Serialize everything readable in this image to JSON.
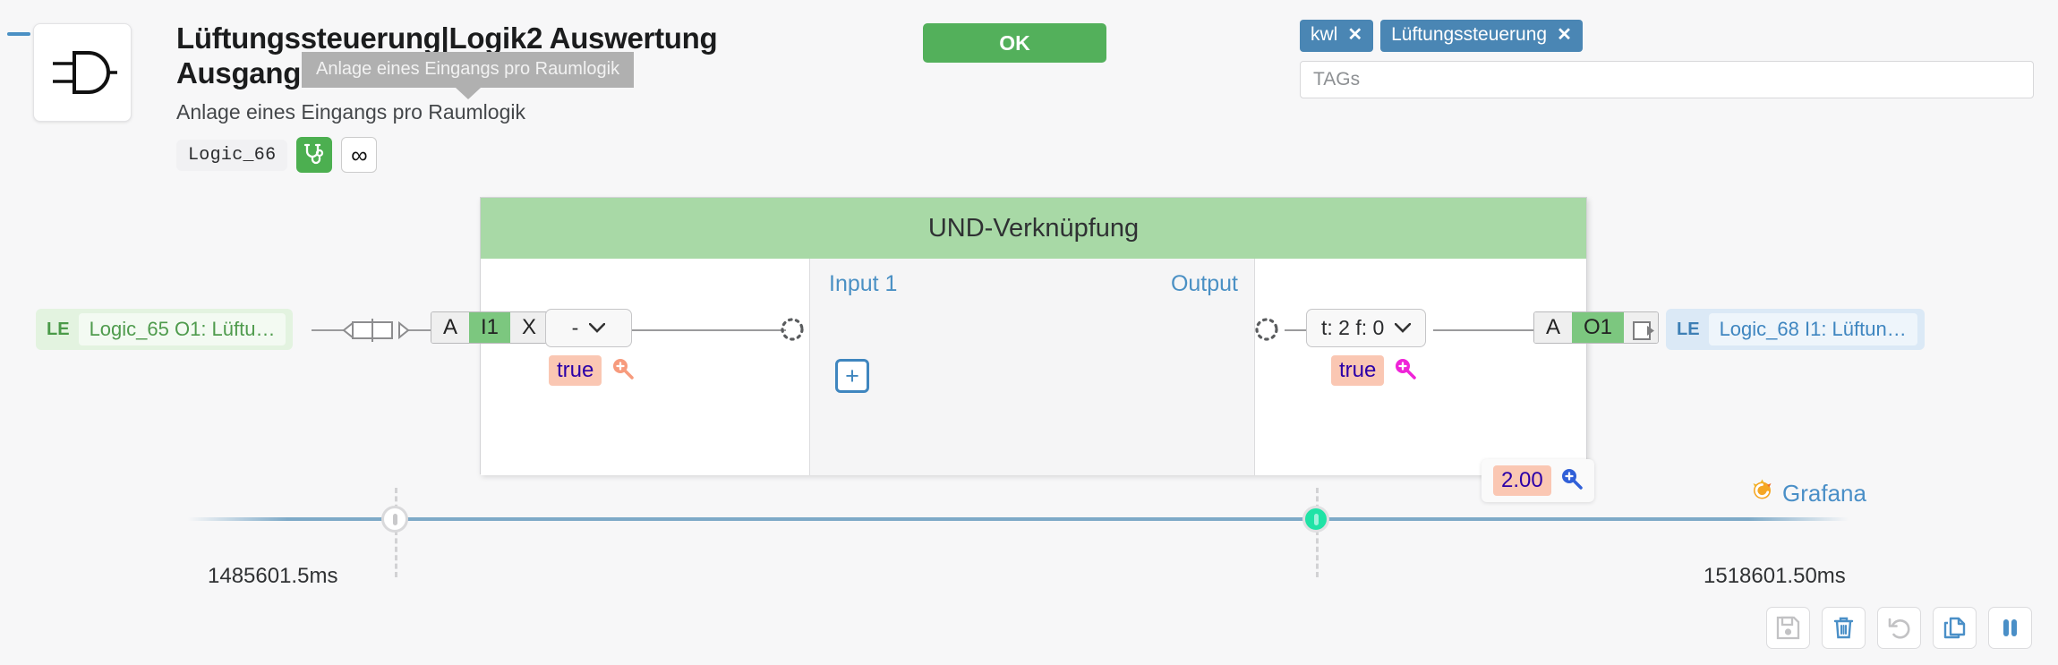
{
  "header": {
    "title": "Lüftungssteuerung|Logik2 Auswertung Ausgang1",
    "subtitle": "Anlage eines Eingangs pro Raumlogik",
    "tooltip": "Anlage eines Eingangs pro Raumlogik",
    "code": "Logic_66",
    "gate_icon": "and-gate-icon",
    "diagnose_icon": "stethoscope-icon",
    "infinity_icon": "infinity-icon",
    "infinity_glyph": "∞",
    "collapse_icon": "minus-collapse-icon",
    "ok_label": "OK",
    "ok_color": "#53b05b"
  },
  "tags": {
    "items": [
      {
        "label": "kwl",
        "remove": "✕"
      },
      {
        "label": "Lüftungssteuerung",
        "remove": "✕"
      }
    ],
    "input_placeholder": "TAGs",
    "input_value": "",
    "tag_color": "#4a86b4"
  },
  "block": {
    "title": "UND-Verknüpfung",
    "title_color": "#a8d9a6",
    "input_label": "Input 1",
    "output_label": "Output",
    "add_input_label": "+"
  },
  "input_side": {
    "source_node": {
      "le": "LE",
      "text": "Logic_65 O1: Lüftu…"
    },
    "pills": {
      "a": "A",
      "index": "I1",
      "x": "X"
    },
    "select_value": "-",
    "caret": "⌄",
    "value": "true",
    "magnifier_icon": "zoom-in-icon"
  },
  "output_side": {
    "select_value": "t: 2 f: 0",
    "caret": "⌄",
    "value": "true",
    "magnifier_icon": "zoom-in-icon",
    "pills": {
      "a": "A",
      "index": "O1"
    },
    "target_node": {
      "le": "LE",
      "text": "Logic_68 I1: Lüftun…"
    }
  },
  "overlay": {
    "result_value": "2.00",
    "result_magnifier_icon": "zoom-in-icon"
  },
  "timeline": {
    "start_time": "1485601.5ms",
    "end_time": "1518601.50ms",
    "left_handle": "timeline-handle-left",
    "right_handle": "timeline-handle-right",
    "line_color": "#7eaac8"
  },
  "grafana": {
    "label": "Grafana",
    "icon": "grafana-logo-icon"
  },
  "toolbar": {
    "buttons": [
      {
        "name": "save-button",
        "icon": "floppy-save-icon",
        "state": "disabled"
      },
      {
        "name": "delete-button",
        "icon": "trash-icon",
        "state": "enabled"
      },
      {
        "name": "undo-button",
        "icon": "undo-arrow-icon",
        "state": "disabled"
      },
      {
        "name": "copy-button",
        "icon": "copy-icon",
        "state": "enabled"
      },
      {
        "name": "pause-button",
        "icon": "pause-icon",
        "state": "enabled"
      }
    ]
  }
}
